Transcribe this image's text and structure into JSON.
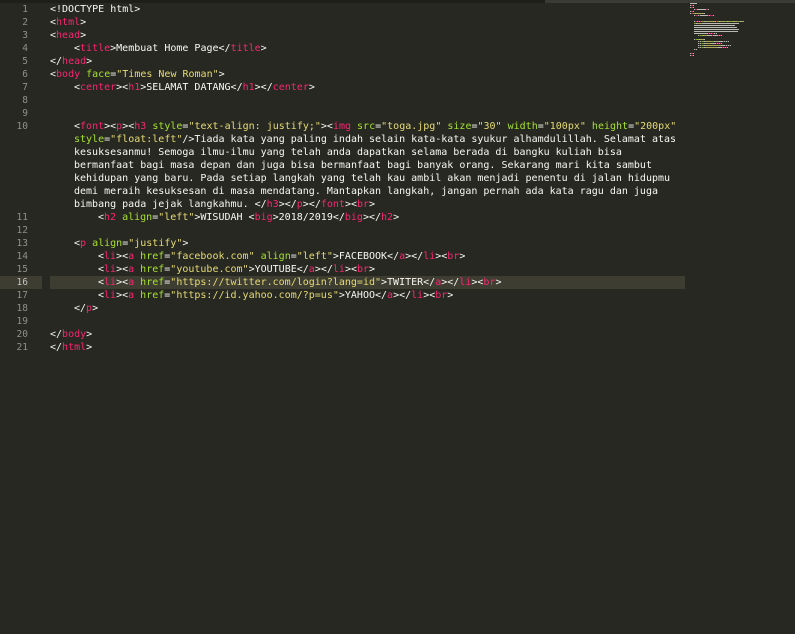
{
  "lines": [
    {
      "n": "1",
      "segments": [
        {
          "t": "<!DOCTYPE html>",
          "c": "tx"
        }
      ]
    },
    {
      "n": "2",
      "segments": [
        {
          "t": "<",
          "c": "tx"
        },
        {
          "t": "html",
          "c": "tg"
        },
        {
          "t": ">",
          "c": "tx"
        }
      ]
    },
    {
      "n": "3",
      "segments": [
        {
          "t": "<",
          "c": "tx"
        },
        {
          "t": "head",
          "c": "tg"
        },
        {
          "t": ">",
          "c": "tx"
        }
      ]
    },
    {
      "n": "4",
      "indent": 1,
      "segments": [
        {
          "t": "<",
          "c": "tx"
        },
        {
          "t": "title",
          "c": "tg"
        },
        {
          "t": ">Membuat Home Page</",
          "c": "tx"
        },
        {
          "t": "title",
          "c": "tg"
        },
        {
          "t": ">",
          "c": "tx"
        }
      ]
    },
    {
      "n": "5",
      "segments": [
        {
          "t": "</",
          "c": "tx"
        },
        {
          "t": "head",
          "c": "tg"
        },
        {
          "t": ">",
          "c": "tx"
        }
      ]
    },
    {
      "n": "6",
      "segments": [
        {
          "t": "<",
          "c": "tx"
        },
        {
          "t": "body",
          "c": "tg"
        },
        {
          "t": " face",
          "c": "at"
        },
        {
          "t": "=",
          "c": "tx"
        },
        {
          "t": "\"Times New Roman\"",
          "c": "st"
        },
        {
          "t": ">",
          "c": "tx"
        }
      ]
    },
    {
      "n": "7",
      "indent": 1,
      "segments": [
        {
          "t": "<",
          "c": "tx"
        },
        {
          "t": "center",
          "c": "tg"
        },
        {
          "t": "><",
          "c": "tx"
        },
        {
          "t": "h1",
          "c": "tg"
        },
        {
          "t": ">SELAMAT DATANG</",
          "c": "tx"
        },
        {
          "t": "h1",
          "c": "tg"
        },
        {
          "t": "></",
          "c": "tx"
        },
        {
          "t": "center",
          "c": "tg"
        },
        {
          "t": ">",
          "c": "tx"
        }
      ]
    },
    {
      "n": "8",
      "segments": []
    },
    {
      "n": "9",
      "segments": []
    },
    {
      "n": "10",
      "indent": 1,
      "segments": [
        {
          "t": "<",
          "c": "tx"
        },
        {
          "t": "font",
          "c": "tg"
        },
        {
          "t": "><",
          "c": "tx"
        },
        {
          "t": "p",
          "c": "tg"
        },
        {
          "t": "><",
          "c": "tx"
        },
        {
          "t": "h3",
          "c": "tg"
        },
        {
          "t": " style",
          "c": "at"
        },
        {
          "t": "=",
          "c": "tx"
        },
        {
          "t": "\"text-align: justify;\"",
          "c": "st"
        },
        {
          "t": "><",
          "c": "tx"
        },
        {
          "t": "img",
          "c": "tg"
        },
        {
          "t": " src",
          "c": "at"
        },
        {
          "t": "=",
          "c": "tx"
        },
        {
          "t": "\"toga.jpg\"",
          "c": "st"
        },
        {
          "t": " size",
          "c": "at"
        },
        {
          "t": "=",
          "c": "tx"
        },
        {
          "t": "\"30\"",
          "c": "st"
        },
        {
          "t": " width",
          "c": "at"
        },
        {
          "t": "=",
          "c": "tx"
        },
        {
          "t": "\"100px\"",
          "c": "st"
        },
        {
          "t": " height",
          "c": "at"
        },
        {
          "t": "=",
          "c": "tx"
        },
        {
          "t": "\"200px\"",
          "c": "st"
        }
      ]
    },
    {
      "n": "",
      "indent": 1,
      "segments": [
        {
          "t": "style",
          "c": "at"
        },
        {
          "t": "=",
          "c": "tx"
        },
        {
          "t": "\"float:left\"",
          "c": "st"
        },
        {
          "t": "/>Tiada kata yang paling indah selain kata-kata syukur alhamdulillah. Selamat atas",
          "c": "tx"
        }
      ]
    },
    {
      "n": "",
      "indent": 1,
      "segments": [
        {
          "t": "kesuksesanmu! Semoga ilmu-ilmu yang telah anda dapatkan selama berada di bangku kuliah bisa",
          "c": "tx"
        }
      ]
    },
    {
      "n": "",
      "indent": 1,
      "segments": [
        {
          "t": "bermanfaat bagi masa depan dan juga bisa bermanfaat bagi banyak orang. Sekarang mari kita sambut",
          "c": "tx"
        }
      ]
    },
    {
      "n": "",
      "indent": 1,
      "segments": [
        {
          "t": "kehidupan yang baru. Pada setiap langkah yang telah kau ambil akan menjadi penentu di jalan hidupmu",
          "c": "tx"
        }
      ]
    },
    {
      "n": "",
      "indent": 1,
      "segments": [
        {
          "t": "demi meraih kesuksesan di masa mendatang. Mantapkan langkah, jangan pernah ada kata ragu dan juga",
          "c": "tx"
        }
      ]
    },
    {
      "n": "",
      "indent": 1,
      "segments": [
        {
          "t": "bimbang pada jejak langkahmu. </",
          "c": "tx"
        },
        {
          "t": "h3",
          "c": "tg"
        },
        {
          "t": "></",
          "c": "tx"
        },
        {
          "t": "p",
          "c": "tg"
        },
        {
          "t": "></",
          "c": "tx"
        },
        {
          "t": "font",
          "c": "tg"
        },
        {
          "t": "><",
          "c": "tx"
        },
        {
          "t": "br",
          "c": "tg"
        },
        {
          "t": ">",
          "c": "tx"
        }
      ]
    },
    {
      "n": "11",
      "indent": 2,
      "segments": [
        {
          "t": "<",
          "c": "tx"
        },
        {
          "t": "h2",
          "c": "tg"
        },
        {
          "t": " align",
          "c": "at"
        },
        {
          "t": "=",
          "c": "tx"
        },
        {
          "t": "\"left\"",
          "c": "st"
        },
        {
          "t": ">WISUDAH <",
          "c": "tx"
        },
        {
          "t": "big",
          "c": "tg"
        },
        {
          "t": ">2018/2019</",
          "c": "tx"
        },
        {
          "t": "big",
          "c": "tg"
        },
        {
          "t": "></",
          "c": "tx"
        },
        {
          "t": "h2",
          "c": "tg"
        },
        {
          "t": ">",
          "c": "tx"
        }
      ]
    },
    {
      "n": "12",
      "segments": []
    },
    {
      "n": "13",
      "indent": 1,
      "segments": [
        {
          "t": "<",
          "c": "tx"
        },
        {
          "t": "p",
          "c": "tg"
        },
        {
          "t": " align",
          "c": "at"
        },
        {
          "t": "=",
          "c": "tx"
        },
        {
          "t": "\"justify\"",
          "c": "st"
        },
        {
          "t": ">",
          "c": "tx"
        }
      ]
    },
    {
      "n": "14",
      "indent": 2,
      "segments": [
        {
          "t": "<",
          "c": "tx"
        },
        {
          "t": "li",
          "c": "tg"
        },
        {
          "t": "><",
          "c": "tx"
        },
        {
          "t": "a",
          "c": "tg"
        },
        {
          "t": " href",
          "c": "at"
        },
        {
          "t": "=",
          "c": "tx"
        },
        {
          "t": "\"facebook.com\"",
          "c": "st"
        },
        {
          "t": " align",
          "c": "at"
        },
        {
          "t": "=",
          "c": "tx"
        },
        {
          "t": "\"left\"",
          "c": "st"
        },
        {
          "t": ">FACEBOOK</",
          "c": "tx"
        },
        {
          "t": "a",
          "c": "tg"
        },
        {
          "t": "></",
          "c": "tx"
        },
        {
          "t": "li",
          "c": "tg"
        },
        {
          "t": "><",
          "c": "tx"
        },
        {
          "t": "br",
          "c": "tg"
        },
        {
          "t": ">",
          "c": "tx"
        }
      ]
    },
    {
      "n": "15",
      "indent": 2,
      "segments": [
        {
          "t": "<",
          "c": "tx"
        },
        {
          "t": "li",
          "c": "tg"
        },
        {
          "t": "><",
          "c": "tx"
        },
        {
          "t": "a",
          "c": "tg"
        },
        {
          "t": " href",
          "c": "at"
        },
        {
          "t": "=",
          "c": "tx"
        },
        {
          "t": "\"youtube.com\"",
          "c": "st"
        },
        {
          "t": ">YOUTUBE</",
          "c": "tx"
        },
        {
          "t": "a",
          "c": "tg"
        },
        {
          "t": "></",
          "c": "tx"
        },
        {
          "t": "li",
          "c": "tg"
        },
        {
          "t": "><",
          "c": "tx"
        },
        {
          "t": "br",
          "c": "tg"
        },
        {
          "t": ">",
          "c": "tx"
        }
      ]
    },
    {
      "n": "16",
      "indent": 2,
      "active": true,
      "segments": [
        {
          "t": "<",
          "c": "tx"
        },
        {
          "t": "li",
          "c": "tg"
        },
        {
          "t": "><",
          "c": "tx"
        },
        {
          "t": "a",
          "c": "tg"
        },
        {
          "t": " href",
          "c": "at"
        },
        {
          "t": "=",
          "c": "tx"
        },
        {
          "t": "\"https://twitter.com/login?lang=id\"",
          "c": "st"
        },
        {
          "t": ">TWITER</",
          "c": "tx"
        },
        {
          "t": "a",
          "c": "tg"
        },
        {
          "t": "></",
          "c": "tx"
        },
        {
          "t": "li",
          "c": "tg"
        },
        {
          "t": "><",
          "c": "tx"
        },
        {
          "t": "br",
          "c": "tg"
        },
        {
          "t": ">",
          "c": "tx"
        }
      ]
    },
    {
      "n": "17",
      "indent": 2,
      "segments": [
        {
          "t": "<",
          "c": "tx"
        },
        {
          "t": "li",
          "c": "tg"
        },
        {
          "t": "><",
          "c": "tx"
        },
        {
          "t": "a",
          "c": "tg"
        },
        {
          "t": " href",
          "c": "at"
        },
        {
          "t": "=",
          "c": "tx"
        },
        {
          "t": "\"https://id.yahoo.com/?p=us\"",
          "c": "st"
        },
        {
          "t": ">YAHOO</",
          "c": "tx"
        },
        {
          "t": "a",
          "c": "tg"
        },
        {
          "t": "></",
          "c": "tx"
        },
        {
          "t": "li",
          "c": "tg"
        },
        {
          "t": "><",
          "c": "tx"
        },
        {
          "t": "br",
          "c": "tg"
        },
        {
          "t": ">",
          "c": "tx"
        }
      ]
    },
    {
      "n": "18",
      "indent": 1,
      "segments": [
        {
          "t": "</",
          "c": "tx"
        },
        {
          "t": "p",
          "c": "tg"
        },
        {
          "t": ">",
          "c": "tx"
        }
      ]
    },
    {
      "n": "19",
      "segments": []
    },
    {
      "n": "20",
      "segments": [
        {
          "t": "</",
          "c": "tx"
        },
        {
          "t": "body",
          "c": "tg"
        },
        {
          "t": ">",
          "c": "tx"
        }
      ]
    },
    {
      "n": "21",
      "segments": [
        {
          "t": "</",
          "c": "tx"
        },
        {
          "t": "html",
          "c": "tg"
        },
        {
          "t": ">",
          "c": "tx"
        }
      ]
    }
  ],
  "colors": {
    "background": "#272822",
    "tag": "#f92672",
    "attribute": "#a6e22e",
    "string": "#e6db74",
    "text": "#f8f8f2",
    "line_number": "#8f908a",
    "active_line": "#3e3d32"
  }
}
